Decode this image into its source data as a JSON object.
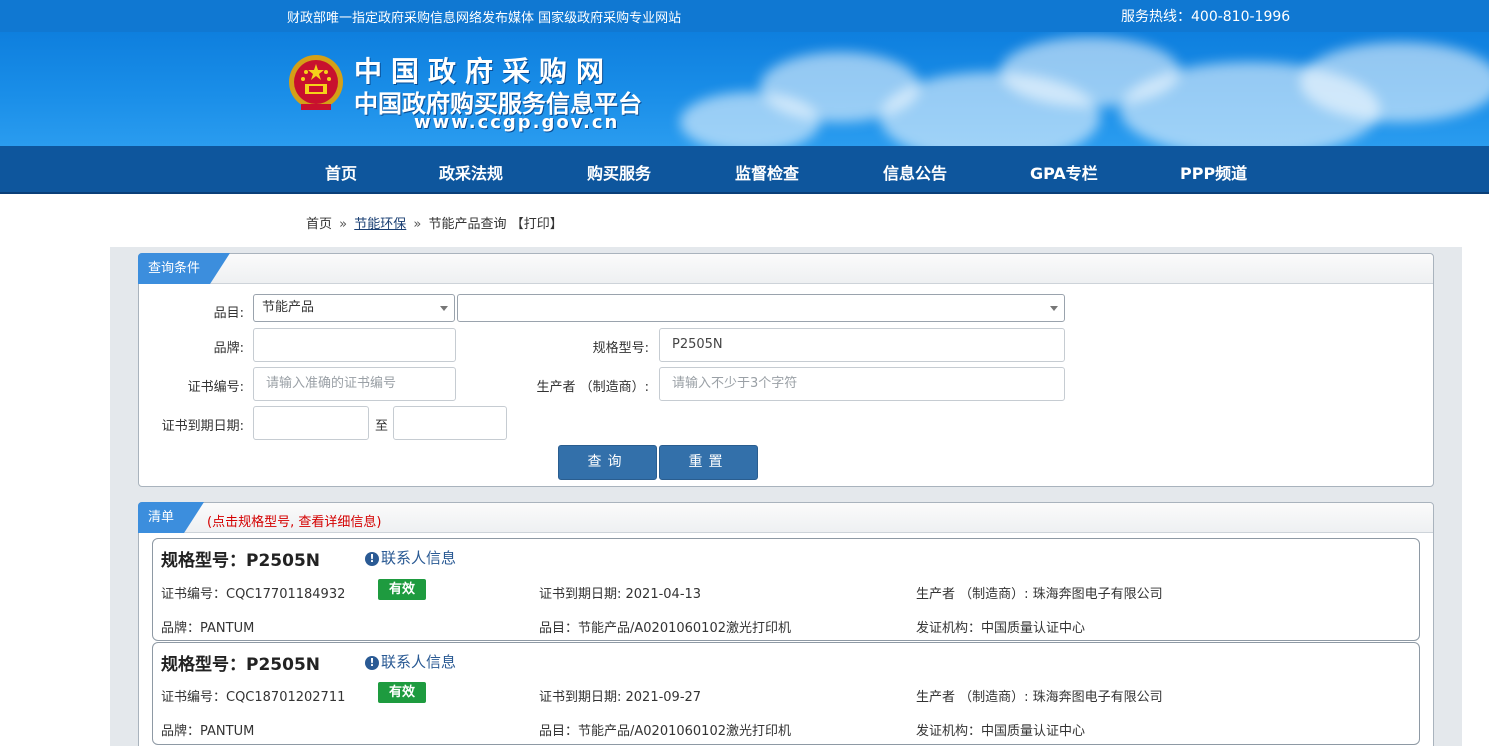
{
  "topbar": {
    "slogan": "财政部唯一指定政府采购信息网络发布媒体 国家级政府采购专业网站",
    "hotline": "服务热线：400-810-1996"
  },
  "banner": {
    "title": "中国政府采购网",
    "subtitle": "中国政府购买服务信息平台",
    "url": "www.ccgp.gov.cn"
  },
  "nav": [
    "首页",
    "政采法规",
    "购买服务",
    "监督检查",
    "信息公告",
    "GPA专栏",
    "PPP频道"
  ],
  "breadcrumb": {
    "home": "首页",
    "sep": "»",
    "section": "节能环保",
    "page": "节能产品查询",
    "print": "【打印】"
  },
  "query": {
    "title": "查询条件",
    "category_label": "品目:",
    "category_value": "节能产品",
    "subcategory_value": "",
    "brand_label": "品牌:",
    "brand_value": "",
    "model_label": "规格型号:",
    "model_value": "P2505N",
    "cert_label": "证书编号:",
    "cert_placeholder": "请输入准确的证书编号",
    "maker_label": "生产者 （制造商）:",
    "maker_placeholder": "请输入不少于3个字符",
    "expiry_label": "证书到期日期:",
    "expiry_to": "至",
    "search_button": "查询",
    "reset_button": "重置"
  },
  "results": {
    "title": "清单",
    "hint": "(点击规格型号, 查看详细信息)",
    "contact_label": "联系人信息",
    "items": [
      {
        "model": "规格型号：P2505N",
        "cert": "证书编号：CQC17701184932",
        "status": "有效",
        "expiry": "证书到期日期: 2021-04-13",
        "maker": "生产者 （制造商）: 珠海奔图电子有限公司",
        "brand": "品牌：PANTUM",
        "category": "品目：节能产品/A0201060102激光打印机",
        "issuer": "发证机构：中国质量认证中心"
      },
      {
        "model": "规格型号：P2505N",
        "cert": "证书编号：CQC18701202711",
        "status": "有效",
        "expiry": "证书到期日期: 2021-09-27",
        "maker": "生产者 （制造商）: 珠海奔图电子有限公司",
        "brand": "品牌：PANTUM",
        "category": "品目：节能产品/A0201060102激光打印机",
        "issuer": "发证机构：中国质量认证中心"
      }
    ]
  },
  "colors": {
    "topbar": "#1078d2",
    "nav": "#0e569d",
    "button": "#3370aa",
    "valid_badge": "#1e9b3f",
    "hint": "#d40000"
  }
}
